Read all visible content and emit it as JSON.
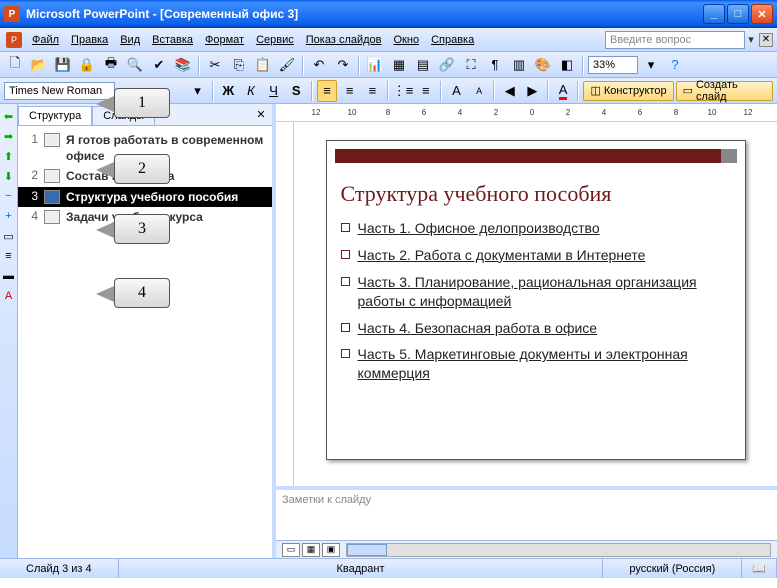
{
  "window": {
    "app": "Microsoft PowerPoint",
    "doc": "[Современный офис 3]"
  },
  "menu": {
    "file": "Файл",
    "edit": "Правка",
    "view": "Вид",
    "insert": "Вставка",
    "format": "Формат",
    "tools": "Сервис",
    "show": "Показ слайдов",
    "window": "Окно",
    "help": "Справка",
    "helpbox_placeholder": "Введите вопрос"
  },
  "toolbar": {
    "zoom": "33%"
  },
  "format": {
    "font": "Times New Roman",
    "designer": "Конструктор",
    "new_slide": "Создать слайд"
  },
  "outline": {
    "tab1": "Структура",
    "tab2": "Слайды",
    "items": [
      {
        "num": "1",
        "title": "Я готов работать в современном офисе"
      },
      {
        "num": "2",
        "title": "Состав комплекса"
      },
      {
        "num": "3",
        "title": "Структура учебного пособия"
      },
      {
        "num": "4",
        "title": "Задачи учебного курса"
      }
    ]
  },
  "slide": {
    "title": "Структура учебного пособия",
    "bullets": [
      "Часть 1. Офисное делопроизводство",
      "Часть 2. Работа с документами в Интернете",
      "Часть 3. Планирование, рациональная организация работы с информацией",
      "Часть 4. Безопасная работа в офисе",
      "Часть 5. Маркетинговые документы и электронная коммерция"
    ]
  },
  "notes": {
    "placeholder": "Заметки к слайду"
  },
  "status": {
    "slide": "Слайд 3 из 4",
    "template": "Квадрант",
    "lang": "русский (Россия)"
  },
  "callouts": {
    "c1": "1",
    "c2": "2",
    "c3": "3",
    "c4": "4"
  },
  "ruler": [
    "12",
    "10",
    "8",
    "6",
    "4",
    "2",
    "0",
    "2",
    "4",
    "6",
    "8",
    "10",
    "12"
  ]
}
